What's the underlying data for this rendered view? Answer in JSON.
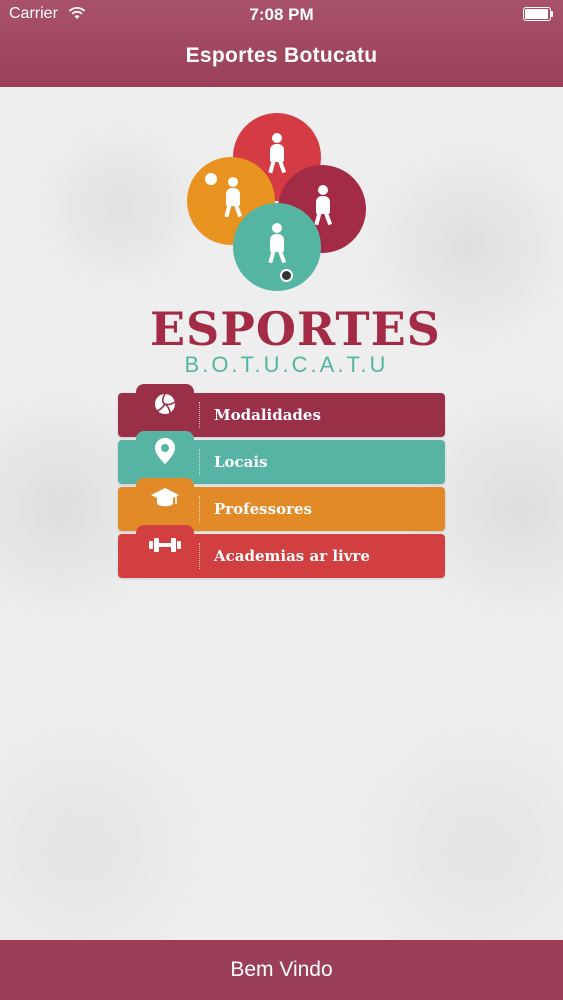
{
  "status_bar": {
    "carrier": "Carrier",
    "time": "7:08 PM"
  },
  "nav": {
    "title": "Esportes Botucatu"
  },
  "logo": {
    "word": "ESPORTES",
    "sub": "B.O.T.U.C.A.T.U",
    "colors": [
      "#d43b45",
      "#e8921f",
      "#a32b45",
      "#55b5a3"
    ]
  },
  "menu": {
    "items": [
      {
        "label": "Modalidades",
        "icon": "volleyball-icon",
        "color": "#9a2f48"
      },
      {
        "label": "Locais",
        "icon": "map-pin-icon",
        "color": "#57b3a3"
      },
      {
        "label": "Professores",
        "icon": "graduation-cap-icon",
        "color": "#e28a27"
      },
      {
        "label": "Academias ar livre",
        "icon": "dumbbell-icon",
        "color": "#d23f41"
      }
    ]
  },
  "footer": {
    "label": "Bem Vindo"
  }
}
